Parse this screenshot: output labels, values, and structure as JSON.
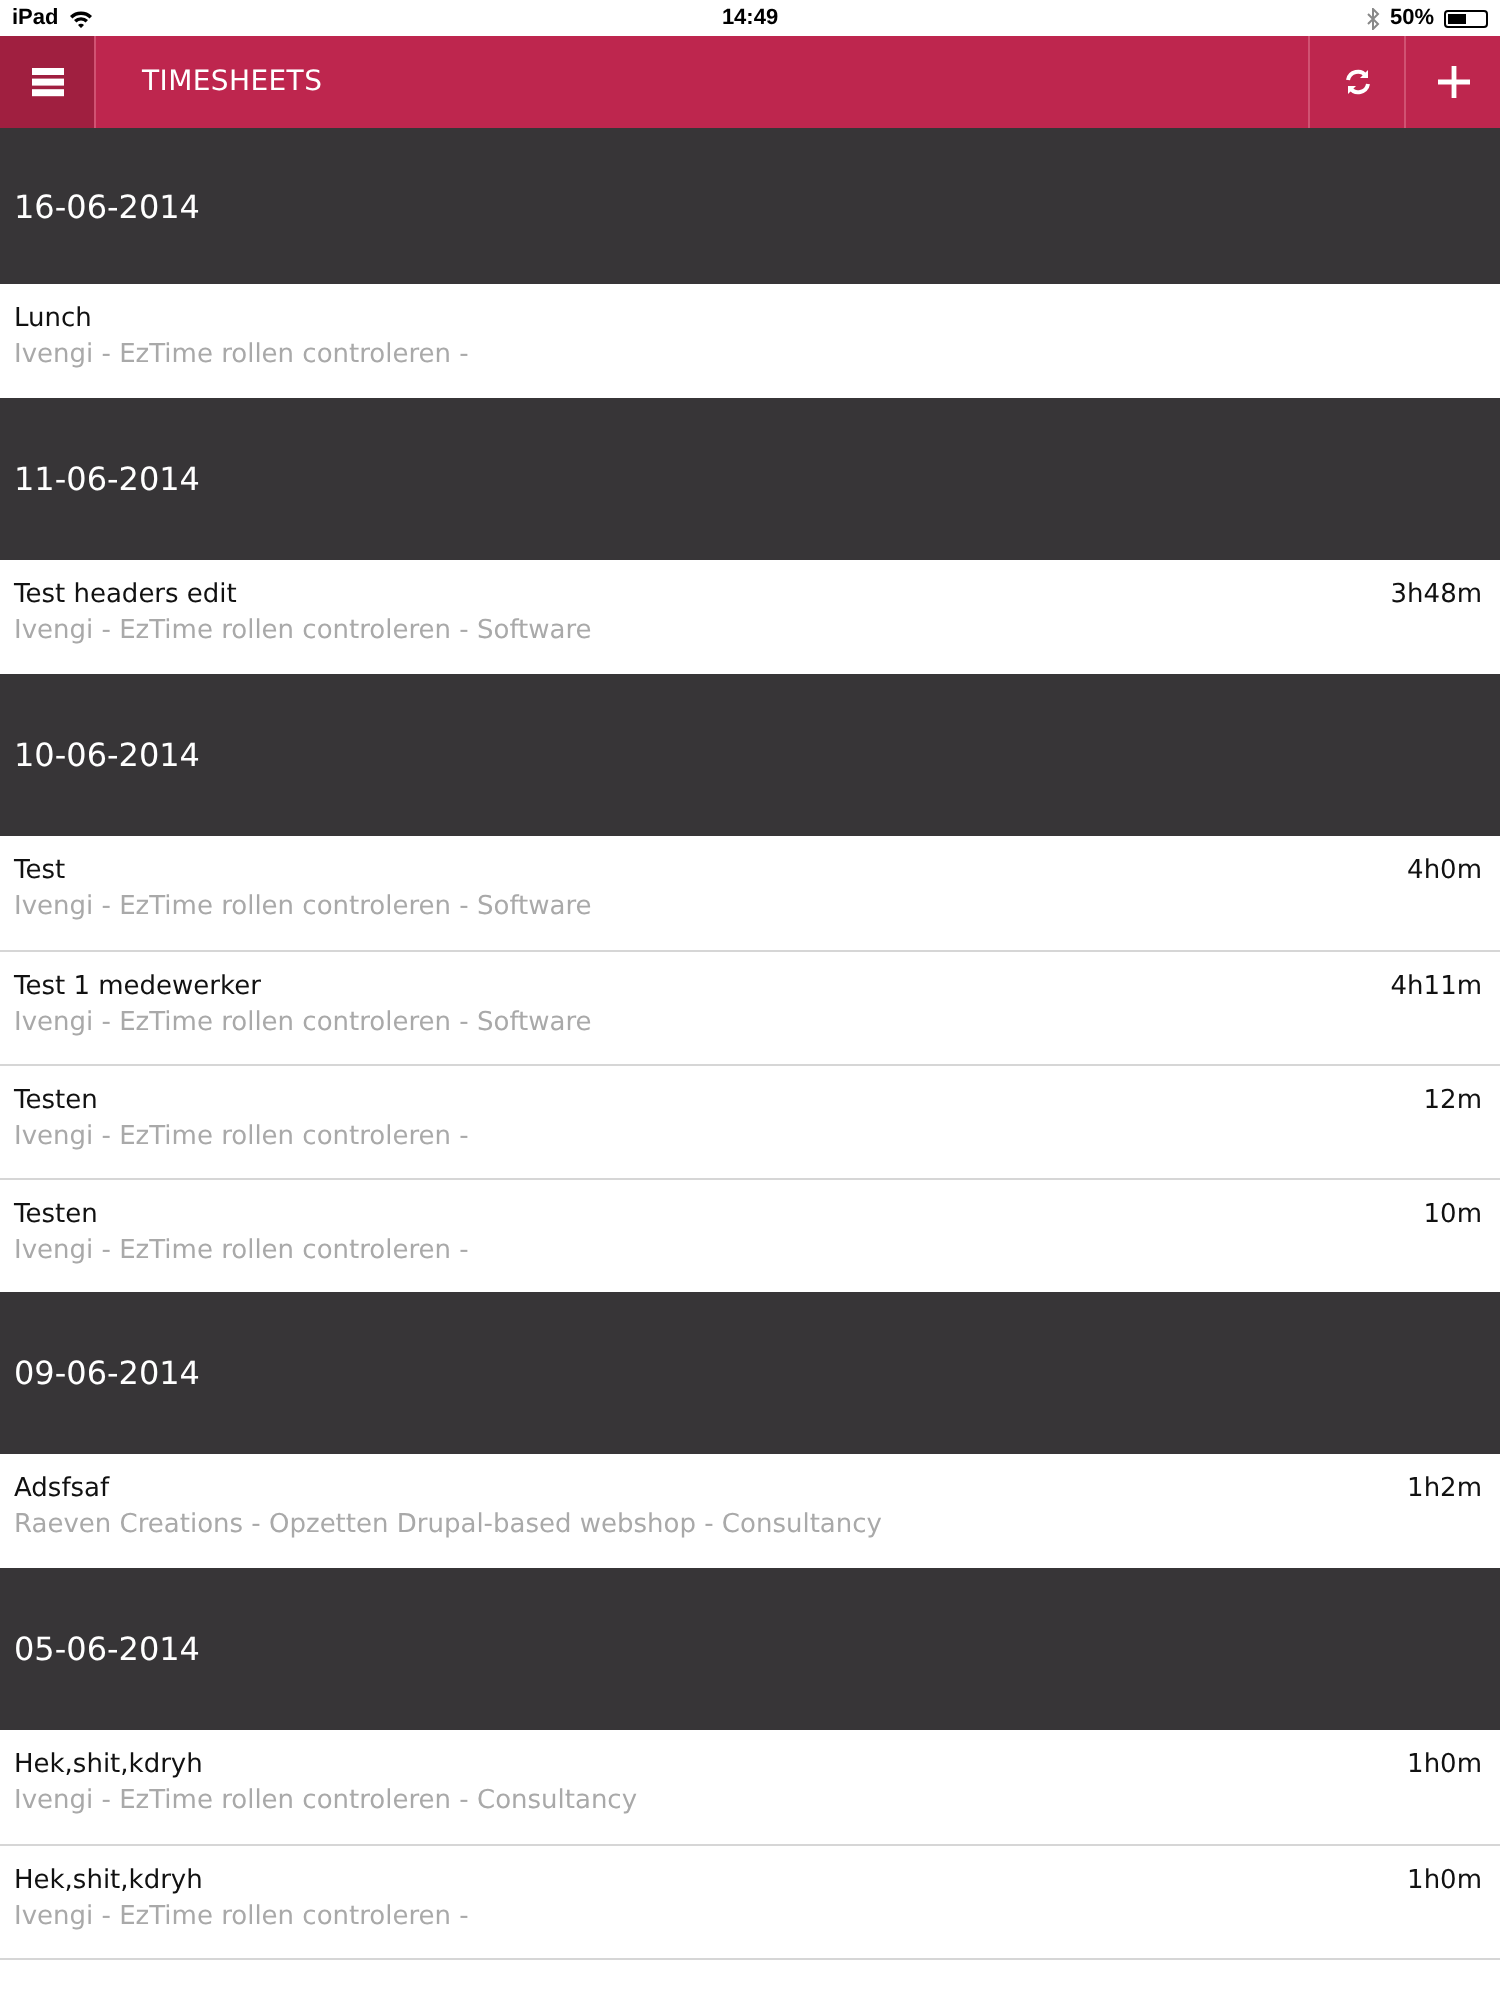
{
  "status_bar": {
    "device": "iPad",
    "time": "14:49",
    "battery": "50%"
  },
  "header": {
    "title": "TIMESHEETS"
  },
  "days": [
    {
      "date": "16-06-2014",
      "entries": [
        {
          "title": "Lunch",
          "subtitle": "Ivengi - EzTime rollen controleren -"
        }
      ]
    },
    {
      "date": "11-06-2014",
      "entries": [
        {
          "title": "Test headers edit",
          "subtitle": "Ivengi - EzTime rollen controleren - Software",
          "duration": "3h48m"
        }
      ]
    },
    {
      "date": "10-06-2014",
      "entries": [
        {
          "title": "Test",
          "subtitle": "Ivengi - EzTime rollen controleren - Software",
          "duration": "4h0m"
        },
        {
          "title": "Test 1 medewerker",
          "subtitle": "Ivengi - EzTime rollen controleren - Software",
          "duration": "4h11m"
        },
        {
          "title": "Testen",
          "subtitle": "Ivengi - EzTime rollen controleren -",
          "duration": "12m"
        },
        {
          "title": "Testen",
          "subtitle": "Ivengi - EzTime rollen controleren -",
          "duration": "10m"
        }
      ]
    },
    {
      "date": "09-06-2014",
      "entries": [
        {
          "title": "Adsfsaf",
          "subtitle": "Raeven Creations - Opzetten Drupal-based webshop - Consultancy",
          "duration": "1h2m"
        }
      ]
    },
    {
      "date": "05-06-2014",
      "entries": [
        {
          "title": "Hek,shit,kdryh",
          "subtitle": "Ivengi - EzTime rollen controleren - Consultancy",
          "duration": "1h0m"
        },
        {
          "title": "Hek,shit,kdryh",
          "subtitle": "Ivengi - EzTime rollen controleren -",
          "duration": "1h0m"
        }
      ]
    }
  ]
}
